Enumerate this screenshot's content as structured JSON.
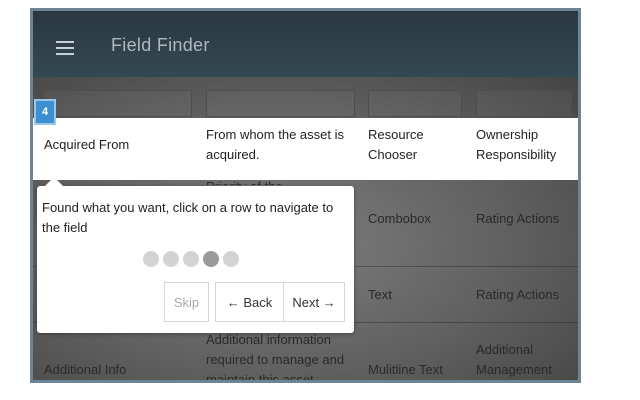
{
  "app": {
    "title": "Field Finder",
    "menu_icon": "hamburger-menu-icon"
  },
  "highlight_row": {
    "name": "Acquired From",
    "description": "From whom the asset is acquired.",
    "type": "Resource Chooser",
    "category": "Ownership Responsibility"
  },
  "dim_rows": [
    {
      "description_partial": "Priority of the",
      "type": "Combobox",
      "category": "Rating Actions"
    },
    {
      "type": "Text",
      "category": "Rating Actions"
    },
    {
      "name": "Additional Info",
      "description": "Additional information required to manage and maintain this asset",
      "type": "Mulitline Text",
      "category": "Additional Management"
    }
  ],
  "step": {
    "number": "4"
  },
  "tooltip": {
    "text": "Found what you want, click on a row to navigate to the field",
    "total_steps": 5,
    "active_step_index": 3,
    "skip_label": "Skip",
    "back_label": "← Back",
    "next_label": "Next →"
  }
}
